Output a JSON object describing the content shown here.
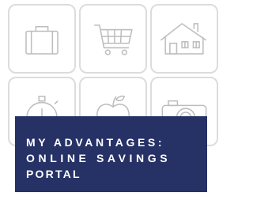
{
  "tiles": [
    {
      "icon": "briefcase-icon"
    },
    {
      "icon": "shopping-cart-icon"
    },
    {
      "icon": "house-icon"
    },
    {
      "icon": "stopwatch-icon"
    },
    {
      "icon": "apple-icon"
    },
    {
      "icon": "camera-icon"
    }
  ],
  "banner": {
    "line1": "MY ADVANTAGES:",
    "line2": "ONLINE SAVINGS",
    "line3": "PORTAL",
    "background_color": "#263166",
    "text_color": "#ffffff"
  },
  "icon_color": "#bdbdbd",
  "tile_border_color": "#dcdcdc"
}
